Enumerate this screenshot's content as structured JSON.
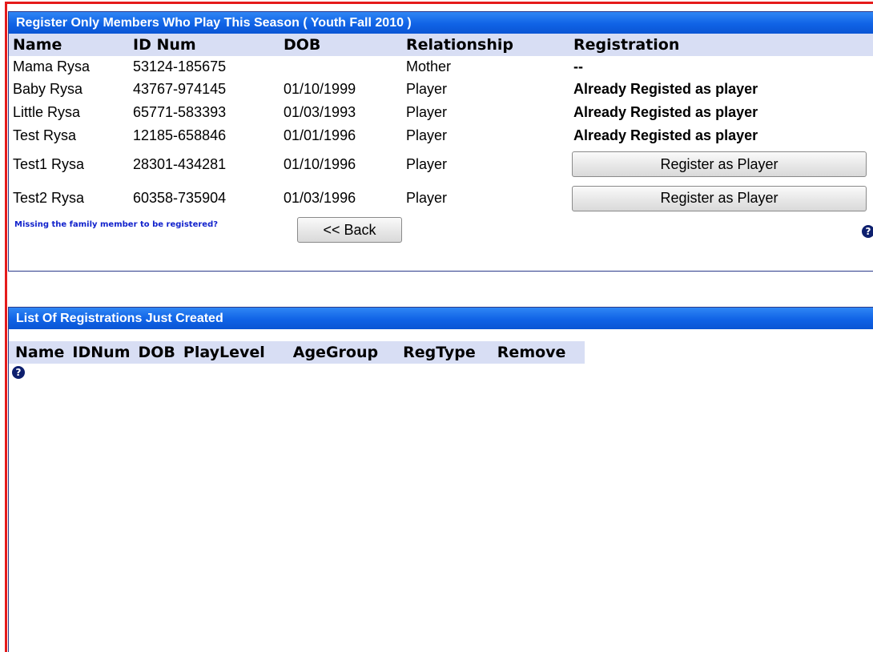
{
  "members_panel": {
    "title": "Register Only Members Who Play This Season ( Youth Fall 2010 )",
    "columns": [
      "Name",
      "ID Num",
      "DOB",
      "Relationship",
      "Registration"
    ],
    "rows": [
      {
        "name": "Mama Rysa",
        "id": "53124-185675",
        "dob": "",
        "relationship": "Mother",
        "registration": "--"
      },
      {
        "name": "Baby Rysa",
        "id": "43767-974145",
        "dob": "01/10/1999",
        "relationship": "Player",
        "registration": "Already Registed as player"
      },
      {
        "name": "Little Rysa",
        "id": "65771-583393",
        "dob": "01/03/1993",
        "relationship": "Player",
        "registration": "Already Registed as player"
      },
      {
        "name": "Test Rysa",
        "id": "12185-658846",
        "dob": "01/01/1996",
        "relationship": "Player",
        "registration": "Already Registed as player"
      },
      {
        "name": "Test1 Rysa",
        "id": "28301-434281",
        "dob": "01/10/1996",
        "relationship": "Player",
        "registration": "Register as Player"
      },
      {
        "name": "Test2 Rysa",
        "id": "60358-735904",
        "dob": "01/03/1996",
        "relationship": "Player",
        "registration": "Register as Player"
      }
    ],
    "missing_link": "Missing the family member to be registered?",
    "back_label": "<< Back",
    "help_icon": "question-circle-icon"
  },
  "registrations_panel": {
    "title": "List Of Registrations Just Created",
    "columns": [
      "Name",
      "IDNum",
      "DOB",
      "PlayLevel",
      "AgeGroup",
      "RegType",
      "Remove"
    ],
    "help_icon": "question-circle-icon"
  },
  "colors": {
    "header_blue": "#1063e6",
    "column_header_bg": "#d8def4",
    "frame_red": "#e51b1b",
    "panel_border": "#2a3a8a",
    "link_blue": "#1122cc"
  }
}
